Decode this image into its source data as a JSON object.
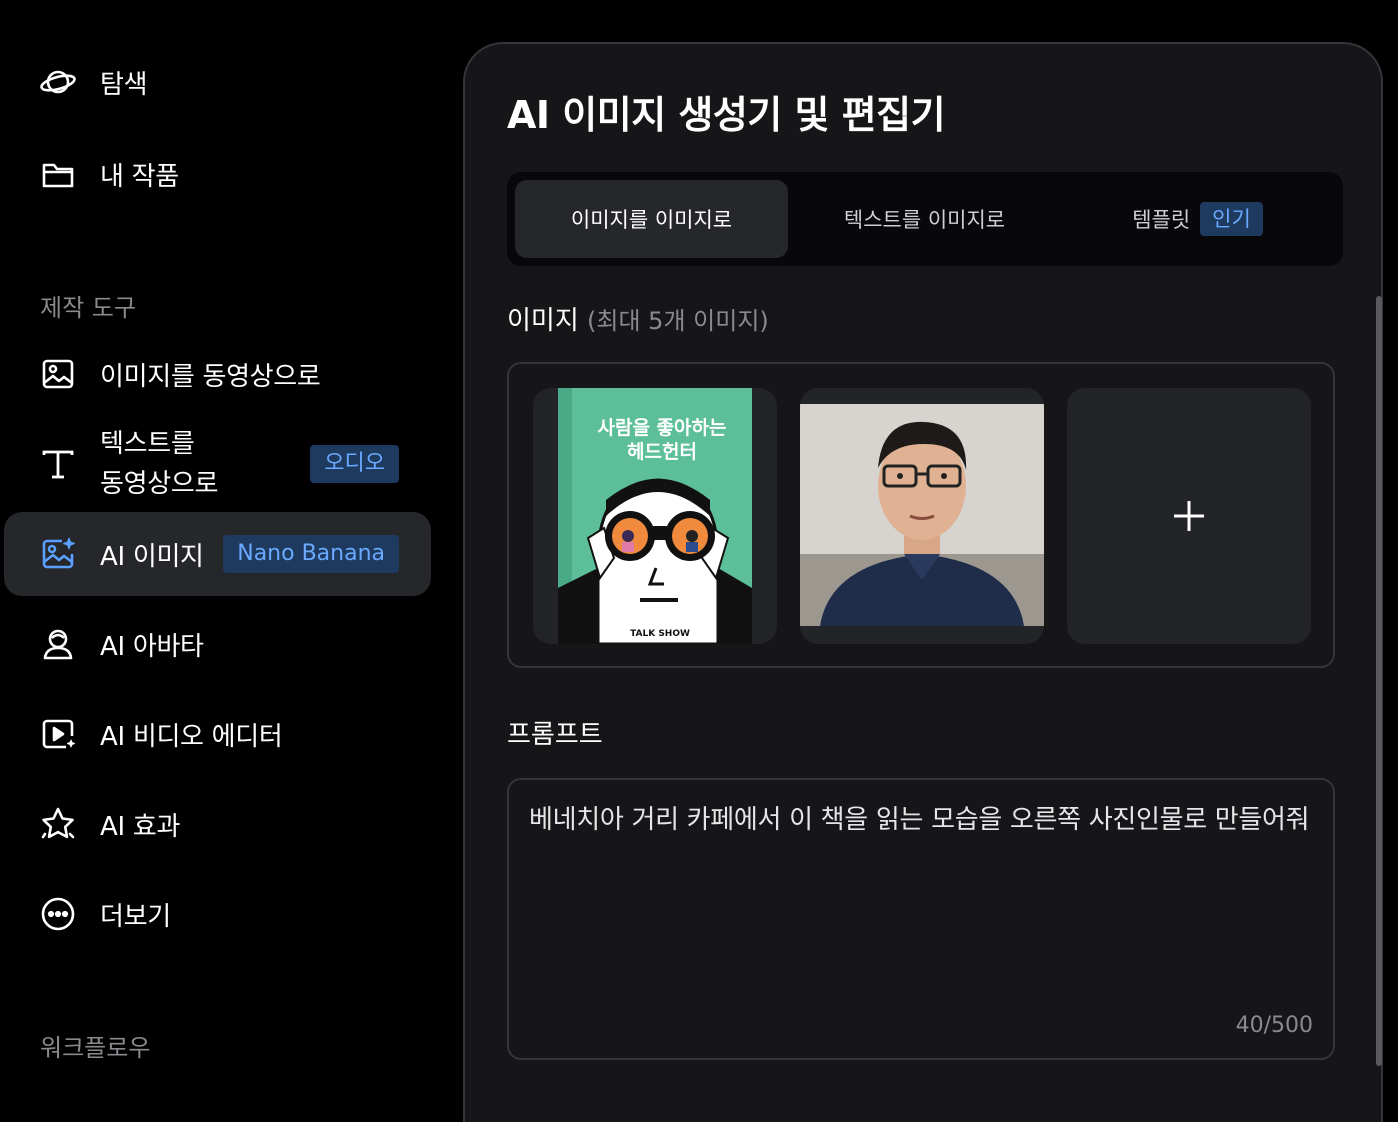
{
  "sidebar": {
    "explore": "탐색",
    "my_works": "내 작품",
    "section_tools": "제작 도구",
    "image_to_video": "이미지를 동영상으로",
    "text_to_video_l1": "텍스트를",
    "text_to_video_l2": "동영상으로",
    "text_to_video_badge": "오디오",
    "ai_image": "AI 이미지",
    "ai_image_badge": "Nano Banana",
    "ai_avatar": "AI 아바타",
    "ai_video_editor": "AI 비디오 에디터",
    "ai_effects": "AI 효과",
    "more": "더보기",
    "section_workflow": "워크플로우"
  },
  "panel": {
    "title": "AI 이미지 생성기 및 편집기",
    "tabs": [
      {
        "label": "이미지를 이미지로",
        "active": true
      },
      {
        "label": "텍스트를 이미지로",
        "active": false
      },
      {
        "label": "템플릿",
        "badge": "인기",
        "active": false
      }
    ],
    "images_label": "이미지",
    "images_hint": "(최대 5개 이미지)",
    "book_title_l1": "사람을 좋아하는",
    "book_title_l2": "헤드헌터",
    "book_publisher": "TALK SHOW",
    "prompt_label": "프롬프트",
    "prompt_text": "베네치아 거리 카페에서 이 책을 읽는 모습을 오른쪽 사진인물로 만들어줘",
    "prompt_counter": "40/500"
  },
  "colors": {
    "accent_badge_bg": "#1e3a5f",
    "accent_badge_text": "#6aa9ff",
    "active_icon": "#5aa0ff",
    "book_green": "#5cbf9a"
  }
}
